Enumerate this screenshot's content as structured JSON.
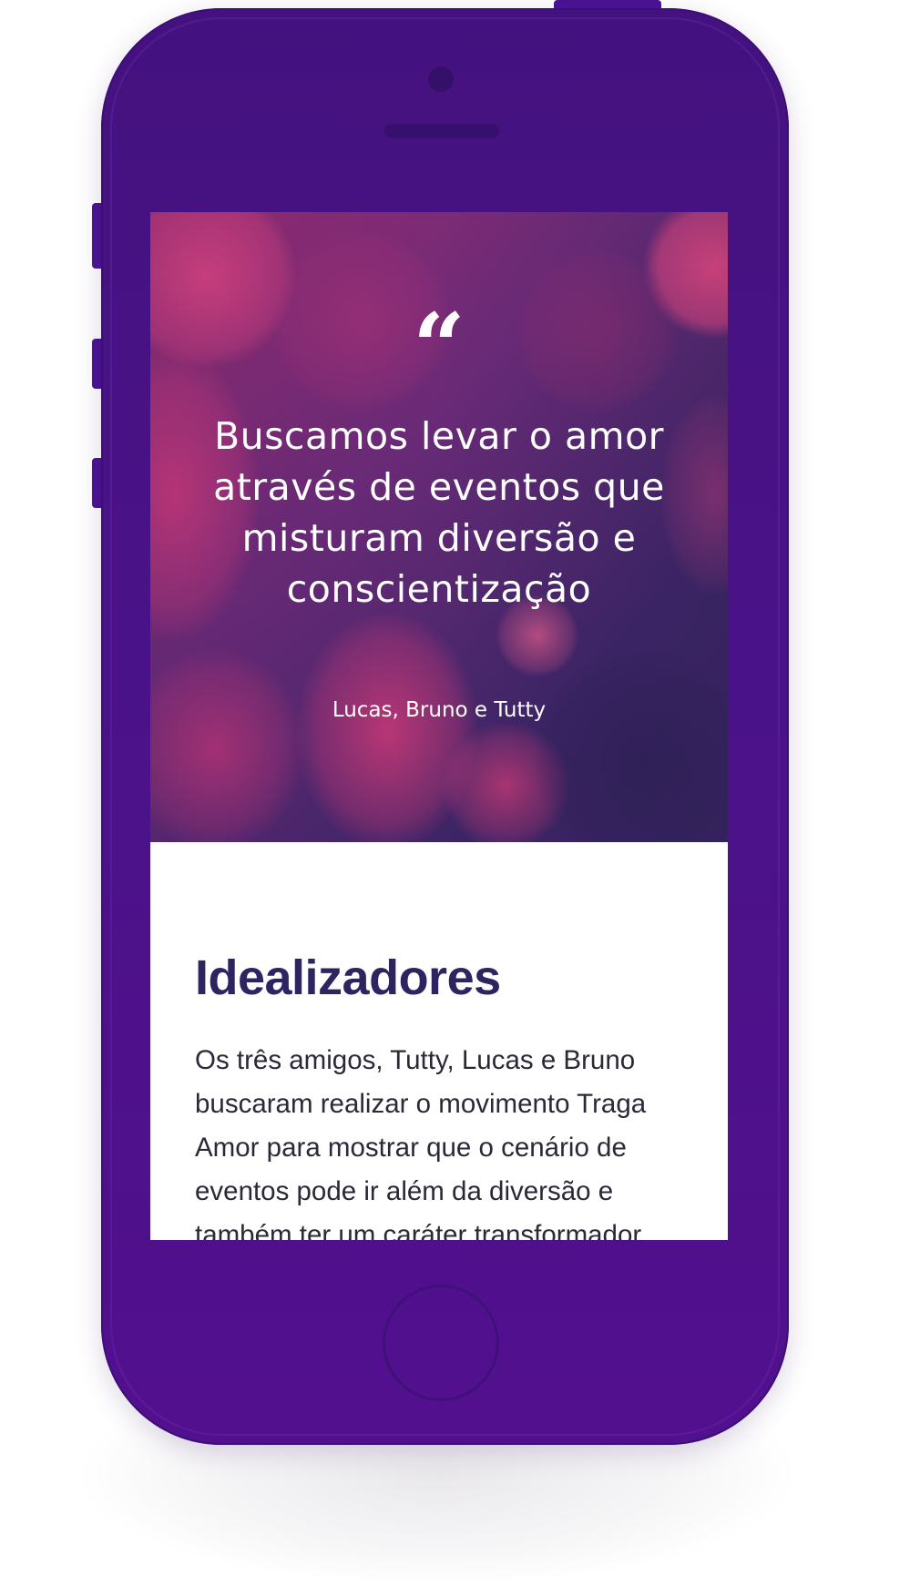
{
  "hero": {
    "quote_mark": "“",
    "quote": "Buscamos levar o amor através de eventos que misturam diversão e conscientização",
    "author": "Lucas, Bruno e Tutty"
  },
  "section": {
    "title": "Idealizadores",
    "body": "Os três amigos, Tutty, Lucas e Bruno buscaram realizar o movimento Traga Amor para mostrar que o cenário de eventos pode ir além da diversão e também ter um caráter transformador."
  },
  "colors": {
    "device_body": "#4a1288",
    "hero_pink": "#e03c7e",
    "hero_purple": "#3d2566",
    "heading": "#2e2460",
    "text": "#2c2838"
  }
}
